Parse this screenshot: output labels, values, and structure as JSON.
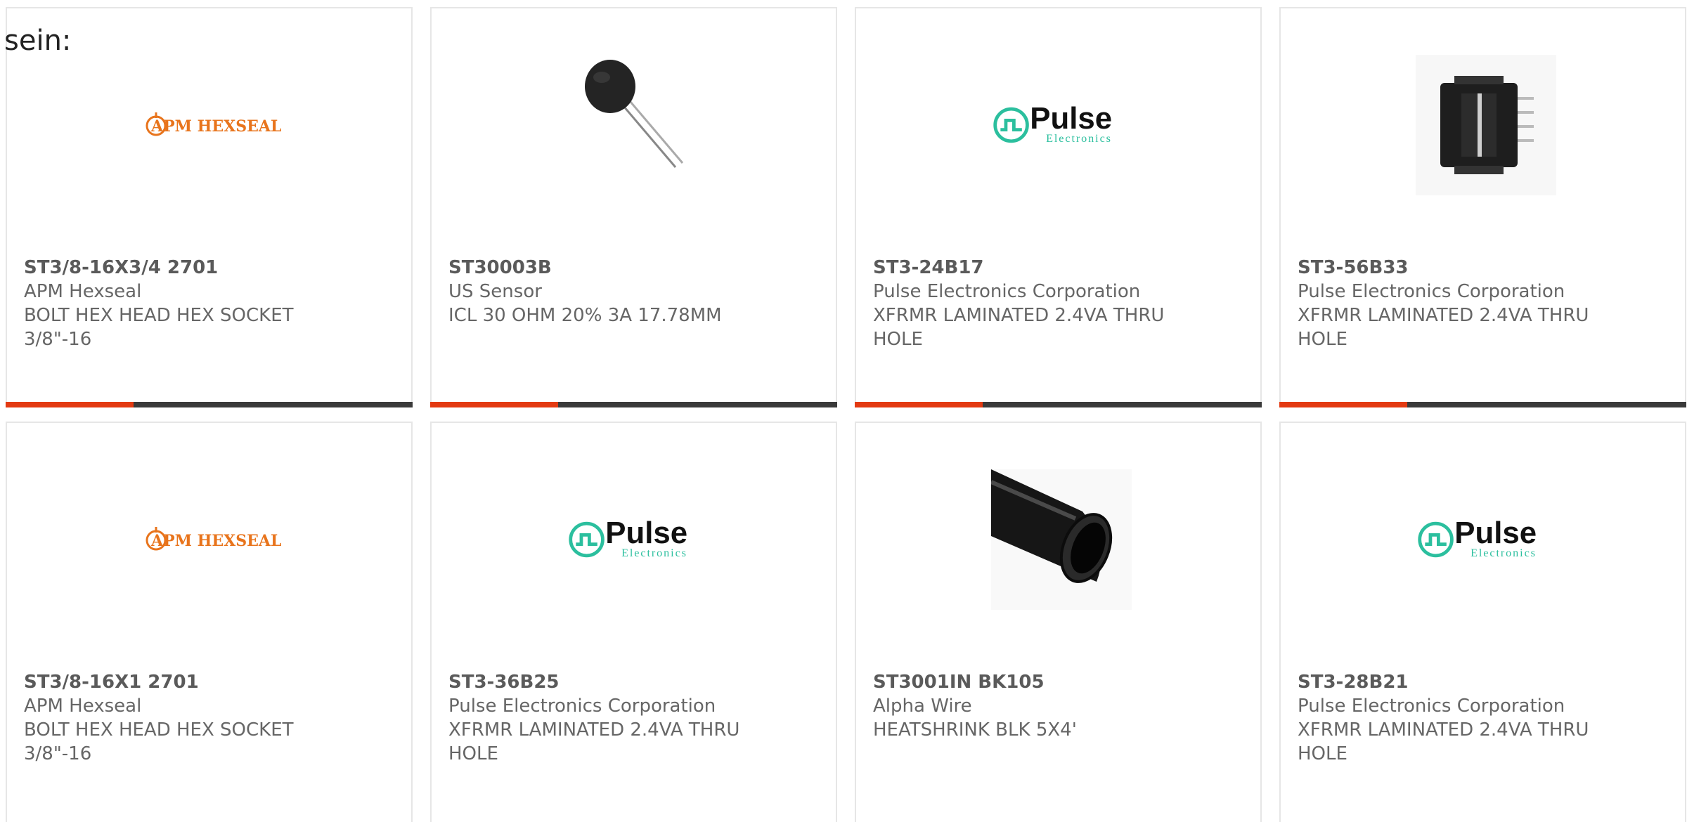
{
  "intro_text": "sein:",
  "colors": {
    "accent": "#e33a12",
    "bar": "#3a3a3a",
    "text": "#666666",
    "border": "#e6e6e6",
    "hexseal": "#e8741c",
    "pulse_teal": "#2bbf9e"
  },
  "products": [
    {
      "part_number": "ST3/8-16X3/4 2701",
      "manufacturer": "APM Hexseal",
      "description": "BOLT HEX HEAD HEX SOCKET 3/8\"-16",
      "image": "apm-hexseal-logo",
      "logo_text": "APM HEXSEAL"
    },
    {
      "part_number": "ST30003B",
      "manufacturer": "US Sensor",
      "description": "ICL 30 OHM 20% 3A 17.78MM",
      "image": "thermistor-photo"
    },
    {
      "part_number": "ST3-24B17",
      "manufacturer": "Pulse Electronics Corporation",
      "description": "XFRMR LAMINATED 2.4VA THRU HOLE",
      "image": "pulse-electronics-logo",
      "logo_text": "Pulse",
      "logo_subtext": "Electronics"
    },
    {
      "part_number": "ST3-56B33",
      "manufacturer": "Pulse Electronics Corporation",
      "description": "XFRMR LAMINATED 2.4VA THRU HOLE",
      "image": "transformer-photo"
    },
    {
      "part_number": "ST3/8-16X1 2701",
      "manufacturer": "APM Hexseal",
      "description": "BOLT HEX HEAD HEX SOCKET 3/8\"-16",
      "image": "apm-hexseal-logo",
      "logo_text": "APM HEXSEAL"
    },
    {
      "part_number": "ST3-36B25",
      "manufacturer": "Pulse Electronics Corporation",
      "description": "XFRMR LAMINATED 2.4VA THRU HOLE",
      "image": "pulse-electronics-logo",
      "logo_text": "Pulse",
      "logo_subtext": "Electronics"
    },
    {
      "part_number": "ST3001IN BK105",
      "manufacturer": "Alpha Wire",
      "description": "HEATSHRINK BLK 5X4'",
      "image": "heatshrink-tube-photo"
    },
    {
      "part_number": "ST3-28B21",
      "manufacturer": "Pulse Electronics Corporation",
      "description": "XFRMR LAMINATED 2.4VA THRU HOLE",
      "image": "pulse-electronics-logo",
      "logo_text": "Pulse",
      "logo_subtext": "Electronics"
    }
  ]
}
